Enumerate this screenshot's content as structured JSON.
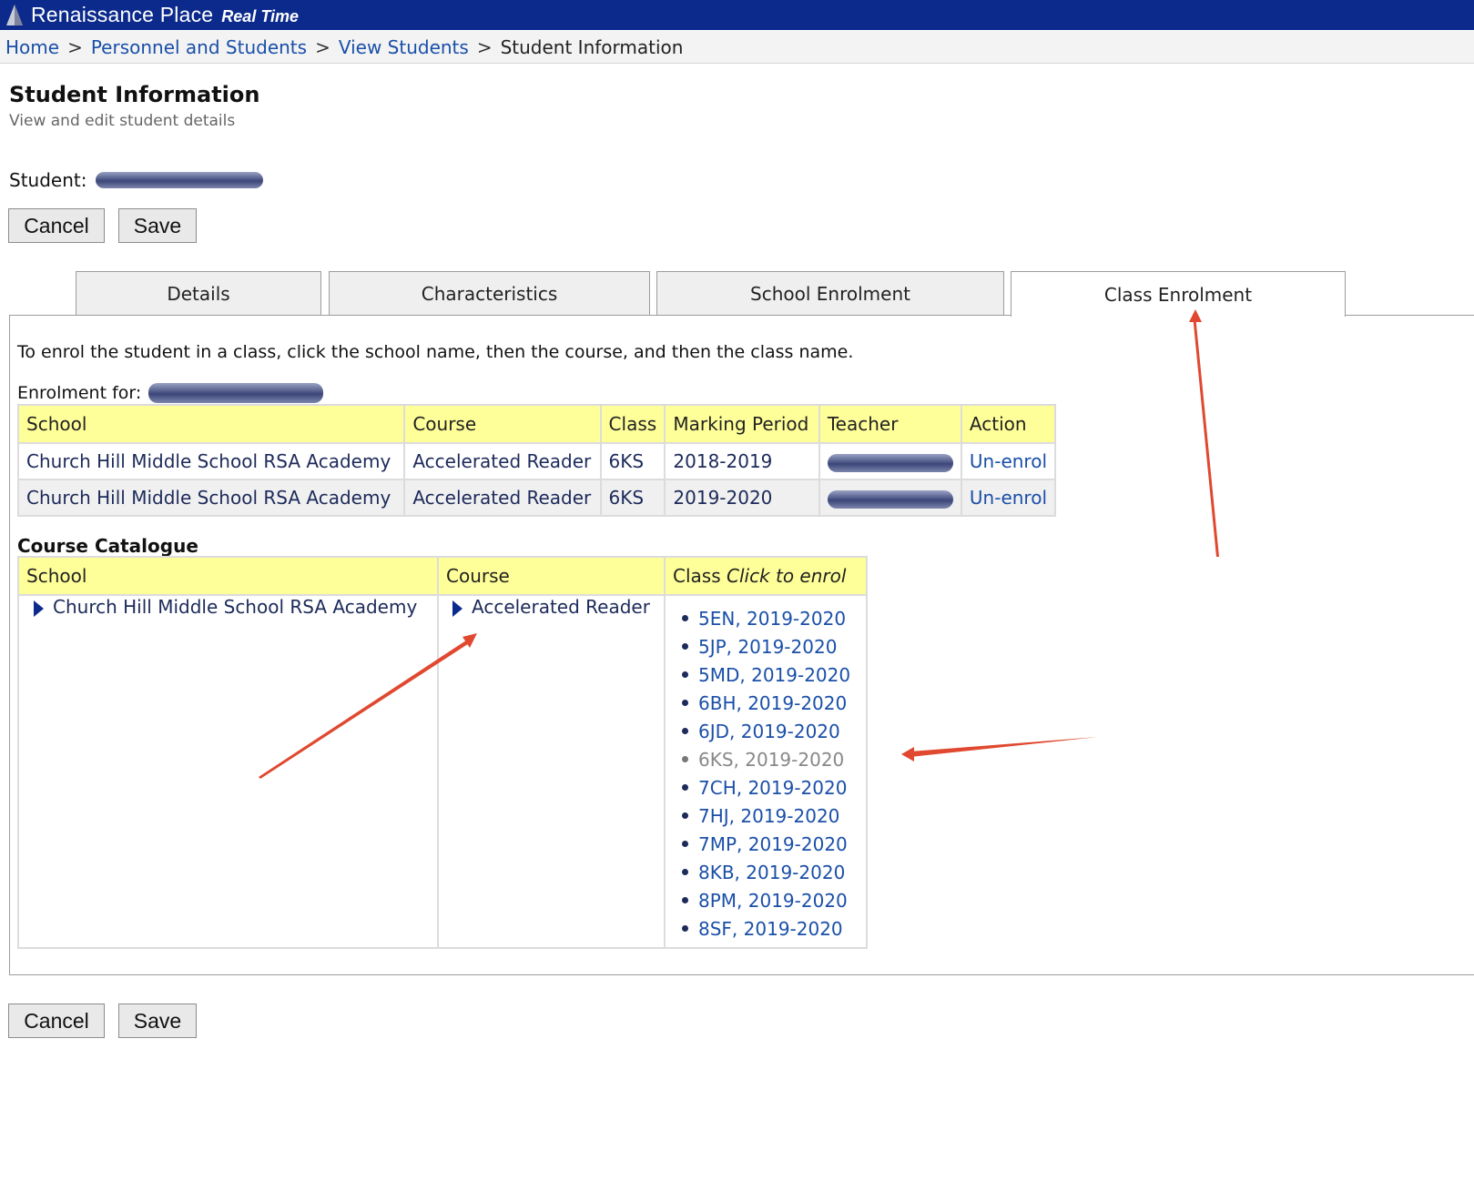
{
  "app": {
    "title": "Renaissance Place",
    "subtitle": "Real Time"
  },
  "breadcrumb": [
    "Home",
    "Personnel and Students",
    "View Students",
    "Student Information"
  ],
  "page": {
    "title": "Student Information",
    "subtitle": "View and edit student details"
  },
  "student": {
    "label": "Student:"
  },
  "buttons": {
    "cancel": "Cancel",
    "save": "Save"
  },
  "tabs": [
    {
      "label": "Details"
    },
    {
      "label": "Characteristics"
    },
    {
      "label": "School Enrolment"
    },
    {
      "label": "Class Enrolment",
      "active": true
    }
  ],
  "instructions": "To enrol the student in a class, click the school name, then the course, and then the class name.",
  "enrolment": {
    "label": "Enrolment for:",
    "headers": [
      "School",
      "Course",
      "Class",
      "Marking Period",
      "Teacher",
      "Action"
    ],
    "rows": [
      {
        "school": "Church Hill Middle School RSA Academy",
        "course": "Accelerated Reader",
        "class": "6KS",
        "period": "2018-2019",
        "action": "Un-enrol"
      },
      {
        "school": "Church Hill Middle School RSA Academy",
        "course": "Accelerated Reader",
        "class": "6KS",
        "period": "2019-2020",
        "action": "Un-enrol"
      }
    ]
  },
  "catalogue": {
    "title": "Course Catalogue",
    "headers": {
      "school": "School",
      "course": "Course",
      "class": "Class",
      "class_hint": "Click to enrol"
    },
    "school": "Church Hill Middle School RSA Academy",
    "course": "Accelerated Reader",
    "classes": [
      "5EN, 2019-2020",
      "5JP, 2019-2020",
      "5MD, 2019-2020",
      "6BH, 2019-2020",
      "6JD, 2019-2020",
      "6KS, 2019-2020",
      "7CH, 2019-2020",
      "7HJ, 2019-2020",
      "7MP, 2019-2020",
      "8KB, 2019-2020",
      "8PM, 2019-2020",
      "8SF, 2019-2020"
    ],
    "enrolled_class": "6KS, 2019-2020"
  },
  "colors": {
    "header_bar": "#0b2a8c",
    "table_header": "#ffff99",
    "link": "#1a4fa8",
    "annotation_arrow": "#e0482f"
  }
}
